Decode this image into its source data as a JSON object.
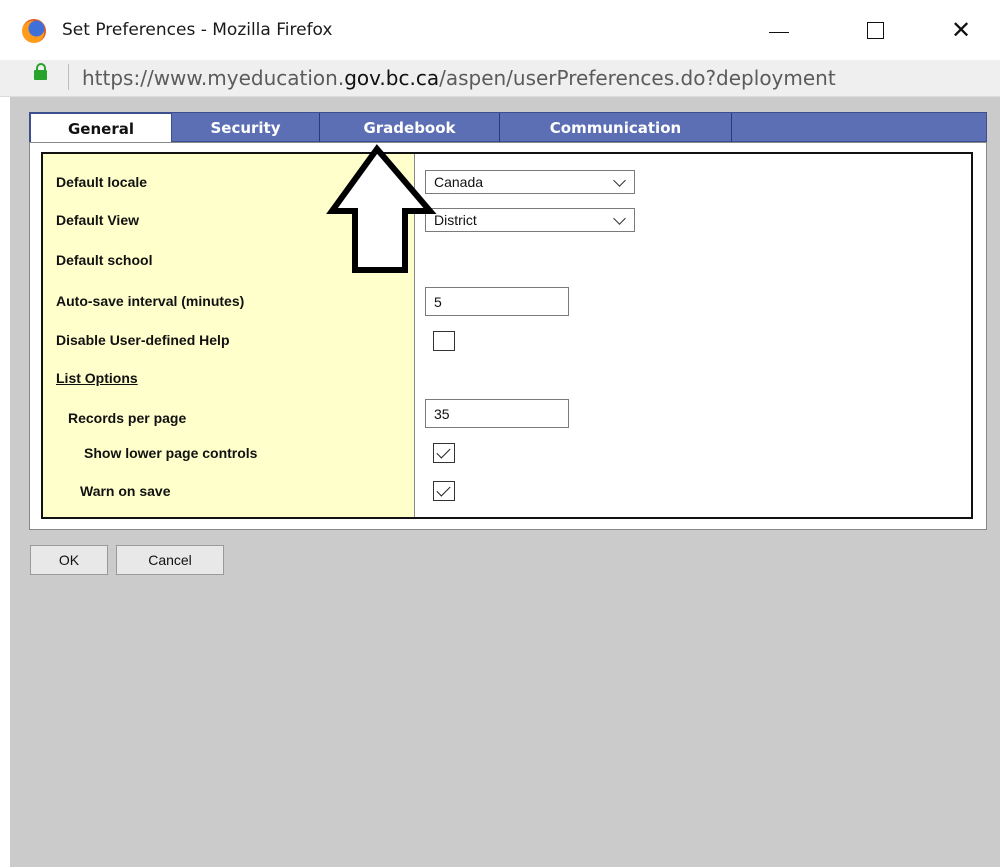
{
  "window": {
    "title": "Set Preferences - Mozilla Firefox",
    "close_glyph": "✕"
  },
  "address_bar": {
    "url_prefix": "https://www.myeducation.",
    "url_domain": "gov.bc.ca",
    "url_suffix": "/aspen/userPreferences.do?deployment"
  },
  "tabs": [
    {
      "label": "General",
      "active": true
    },
    {
      "label": "Security",
      "active": false
    },
    {
      "label": "Gradebook",
      "active": false
    },
    {
      "label": "Communication",
      "active": false
    }
  ],
  "form": {
    "default_locale": {
      "label": "Default locale",
      "value": "Canada"
    },
    "default_view": {
      "label": "Default View",
      "value": "District"
    },
    "default_school": {
      "label": "Default school"
    },
    "auto_save": {
      "label": "Auto-save interval (minutes)",
      "value": "5"
    },
    "disable_help": {
      "label": "Disable User-defined Help",
      "checked": false
    },
    "list_options": {
      "label": "List Options"
    },
    "records_per_page": {
      "label": "Records per page",
      "value": "35"
    },
    "show_lower_controls": {
      "label": "Show lower page controls",
      "checked": true
    },
    "warn_on_save": {
      "label": "Warn on save",
      "checked": true
    }
  },
  "buttons": {
    "ok": "OK",
    "cancel": "Cancel"
  },
  "icons": {
    "browser": "firefox-icon",
    "lock": "lock-icon",
    "annotation": "up-arrow-icon"
  },
  "colors": {
    "tab_bar": "#5c6fb4",
    "label_column": "#ffffcc",
    "page_background": "#cbcbcb"
  }
}
